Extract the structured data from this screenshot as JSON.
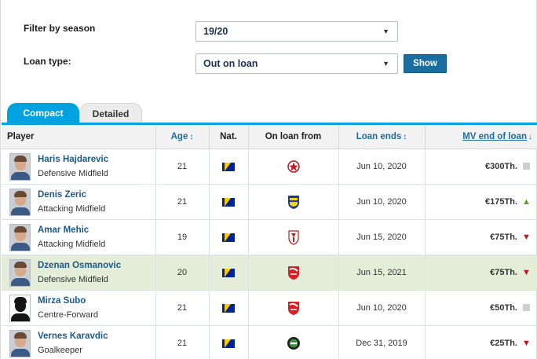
{
  "filters": {
    "season_label": "Filter by season",
    "season_value": "19/20",
    "loan_label": "Loan type:",
    "loan_value": "Out on loan",
    "show_label": "Show"
  },
  "tabs": [
    {
      "label": "Compact",
      "active": true
    },
    {
      "label": "Detailed",
      "active": false
    }
  ],
  "table": {
    "headers": {
      "player": "Player",
      "age": "Age",
      "nat": "Nat.",
      "loan_from": "On loan from",
      "loan_ends": "Loan ends",
      "mv": "MV end of loan"
    },
    "rows": [
      {
        "name": "Haris Hajdarevic",
        "position": "Defensive Midfield",
        "age": "21",
        "nationality": "flag-bosnia-icon",
        "club_crest": "red-star-crest-icon",
        "loan_ends": "Jun 10, 2020",
        "mv": "€300Th.",
        "trend": "neutral",
        "highlight": false
      },
      {
        "name": "Denis Zeric",
        "position": "Attacking Midfield",
        "age": "21",
        "nationality": "flag-bosnia-icon",
        "club_crest": "blue-yellow-crest-icon",
        "loan_ends": "Jun 10, 2020",
        "mv": "€175Th.",
        "trend": "up",
        "highlight": false
      },
      {
        "name": "Amar Mehic",
        "position": "Attacking Midfield",
        "age": "19",
        "nationality": "flag-bosnia-icon",
        "club_crest": "red-white-shield-crest-icon",
        "loan_ends": "Jun 15, 2020",
        "mv": "€75Th.",
        "trend": "down",
        "highlight": false
      },
      {
        "name": "Dzenan Osmanovic",
        "position": "Defensive Midfield",
        "age": "20",
        "nationality": "flag-bosnia-icon",
        "club_crest": "red-shield-crest-icon",
        "loan_ends": "Jun 15, 2021",
        "mv": "€75Th.",
        "trend": "down",
        "highlight": true
      },
      {
        "name": "Mirza Subo",
        "position": "Centre-Forward",
        "age": "21",
        "nationality": "flag-bosnia-icon",
        "club_crest": "red-shield-crest-icon",
        "loan_ends": "Jun 10, 2020",
        "mv": "€50Th.",
        "trend": "neutral",
        "highlight": false
      },
      {
        "name": "Vernes Karavdic",
        "position": "Goalkeeper",
        "age": "21",
        "nationality": "flag-bosnia-icon",
        "club_crest": "green-black-crest-icon",
        "loan_ends": "Dec 31, 2019",
        "mv": "€25Th.",
        "trend": "down",
        "highlight": false
      }
    ]
  },
  "colors": {
    "accent": "#00a3e0",
    "link": "#1a5a8c",
    "button": "#1a6ea0",
    "highlight_row": "#e3edd8",
    "trend_up": "#5ca423",
    "trend_down": "#c0141f"
  }
}
